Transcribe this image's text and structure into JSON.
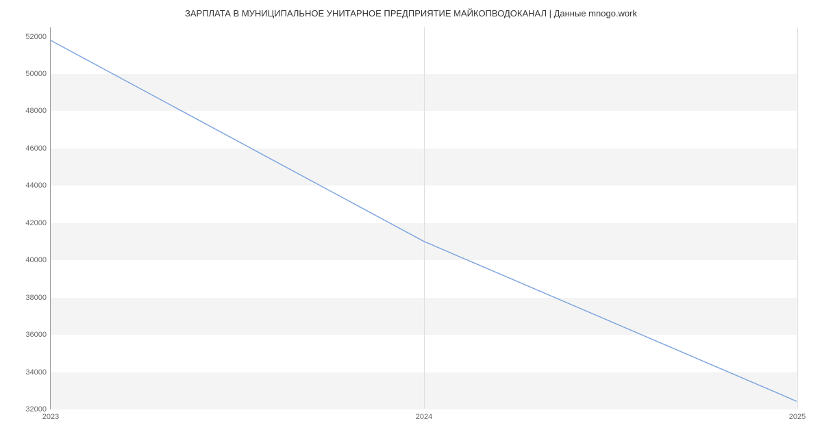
{
  "chart_data": {
    "type": "line",
    "title": "ЗАРПЛАТА В МУНИЦИПАЛЬНОЕ УНИТАРНОЕ ПРЕДПРИЯТИЕ МАЙКОПВОДОКАНАЛ | Данные mnogo.work",
    "xlabel": "",
    "ylabel": "",
    "x": [
      2023,
      2024,
      2025
    ],
    "values": [
      51800,
      41000,
      32400
    ],
    "y_ticks": [
      32000,
      34000,
      36000,
      38000,
      40000,
      42000,
      44000,
      46000,
      48000,
      50000,
      52000
    ],
    "x_ticks": [
      2023,
      2024,
      2025
    ],
    "ylim": [
      32000,
      52500
    ],
    "xlim": [
      2023,
      2025
    ],
    "line_color": "#7ea6e0",
    "banded_grid": true
  }
}
